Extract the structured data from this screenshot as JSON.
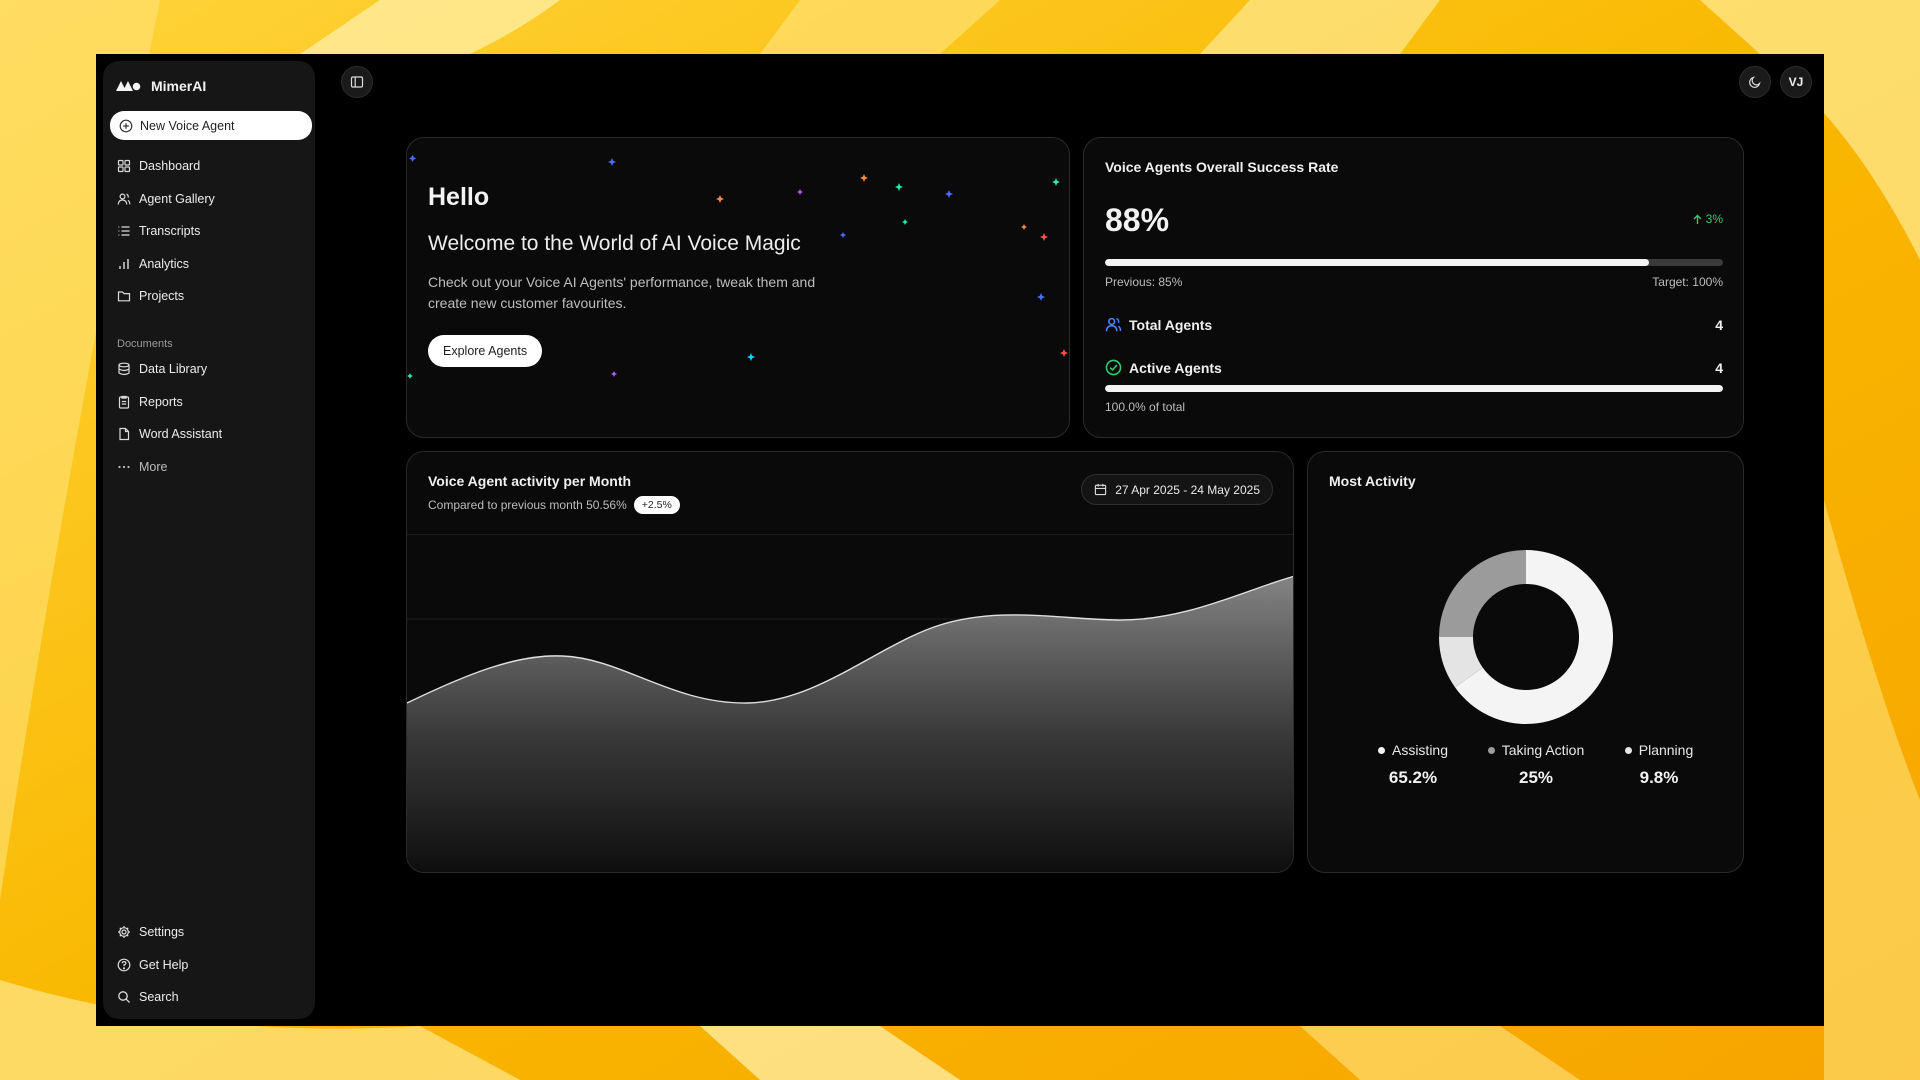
{
  "brand": {
    "name": "MimerAI"
  },
  "sidebar": {
    "new_agent_label": "New Voice Agent",
    "primary": [
      {
        "label": "Dashboard",
        "icon": "grid-icon"
      },
      {
        "label": "Agent Gallery",
        "icon": "users-icon"
      },
      {
        "label": "Transcripts",
        "icon": "list-icon"
      },
      {
        "label": "Analytics",
        "icon": "bar-chart-icon"
      },
      {
        "label": "Projects",
        "icon": "folder-icon"
      }
    ],
    "documents_label": "Documents",
    "documents": [
      {
        "label": "Data Library",
        "icon": "database-icon"
      },
      {
        "label": "Reports",
        "icon": "clipboard-icon"
      },
      {
        "label": "Word Assistant",
        "icon": "file-icon"
      },
      {
        "label": "More",
        "icon": "ellipsis-icon"
      }
    ],
    "footer": [
      {
        "label": "Settings",
        "icon": "gear-icon"
      },
      {
        "label": "Get Help",
        "icon": "help-icon"
      },
      {
        "label": "Search",
        "icon": "search-icon"
      }
    ]
  },
  "topbar": {
    "avatar_initials": "VJ"
  },
  "hello": {
    "title": "Hello",
    "subtitle": "Welcome to the World of AI Voice Magic",
    "description": "Check out your Voice AI Agents' performance, tweak them and create new customer favourites.",
    "button_label": "Explore Agents"
  },
  "success": {
    "title": "Voice Agents Overall Success Rate",
    "value": "88%",
    "value_fraction": 0.88,
    "change": "3%",
    "previous": "Previous: 85%",
    "target": "Target: 100%",
    "total_agents_label": "Total Agents",
    "total_agents_value": "4",
    "active_agents_label": "Active Agents",
    "active_agents_value": "4",
    "active_fraction": 1.0,
    "active_note": "100.0% of total"
  },
  "activity": {
    "title": "Voice Agent activity per Month",
    "compared": "Compared to previous month 50.56%",
    "badge": "+2.5%",
    "date_range": "27 Apr 2025 - 24 May 2025"
  },
  "most_activity": {
    "title": "Most Activity",
    "legend": [
      {
        "label": "Assisting",
        "value": "65.2%",
        "color": "#f4f4f4"
      },
      {
        "label": "Taking Action",
        "value": "25%",
        "color": "#9b9b9b"
      },
      {
        "label": "Planning",
        "value": "9.8%",
        "color": "#e4e4e4"
      }
    ]
  },
  "colors": {
    "accent_green": "#2ecc71",
    "accent_blue": "#4a8cff",
    "background": "#000000",
    "card": "#0a0a0a"
  }
}
